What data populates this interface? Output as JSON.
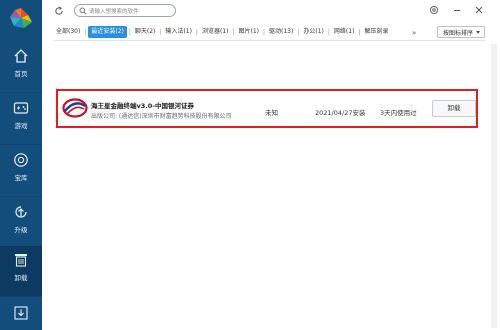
{
  "sidebar": {
    "items": [
      {
        "label": "首页",
        "icon": "home-icon"
      },
      {
        "label": "游戏",
        "icon": "gamepad-icon"
      },
      {
        "label": "宝库",
        "icon": "treasure-icon"
      },
      {
        "label": "升级",
        "icon": "upgrade-icon"
      },
      {
        "label": "卸载",
        "icon": "trash-icon",
        "active": true
      }
    ],
    "bottom_icon": "download-icon"
  },
  "search": {
    "placeholder": "请输入想搜索的软件"
  },
  "tabs": [
    {
      "label": "全部(30)"
    },
    {
      "label": "最近安装(2)",
      "active": true
    },
    {
      "label": "聊天(2)"
    },
    {
      "label": "输入法(1)"
    },
    {
      "label": "浏览器(1)"
    },
    {
      "label": "图片(1)"
    },
    {
      "label": "驱动(13)"
    },
    {
      "label": "办公(1)"
    },
    {
      "label": "网络(1)"
    },
    {
      "label": "解压刻录"
    }
  ],
  "more": "»",
  "sort": {
    "label": "按图标排序"
  },
  "app": {
    "name": "海王星金融终端v3.0-中国银河证券",
    "publisher": "出版公司: (通达信)深圳市财富趋势科技股份有限公司",
    "size": "未知",
    "install_date": "2021/04/27安装",
    "usage": "3天内使用过",
    "uninstall_label": "卸载"
  },
  "colors": {
    "sidebar": "#134d7c",
    "accent": "#2a8fe0",
    "highlight": "#e02020"
  }
}
